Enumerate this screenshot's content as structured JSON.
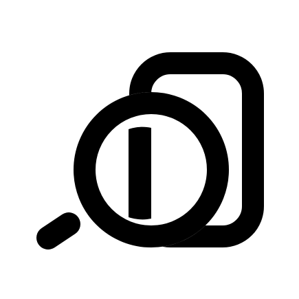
{
  "icon": {
    "name": "document-search-icon",
    "parts": [
      "document-outline",
      "magnifier-lens",
      "magnifier-handle",
      "document-segment-inside-lens"
    ]
  },
  "colors": {
    "background": "#ffffff",
    "foreground": "#000000"
  }
}
